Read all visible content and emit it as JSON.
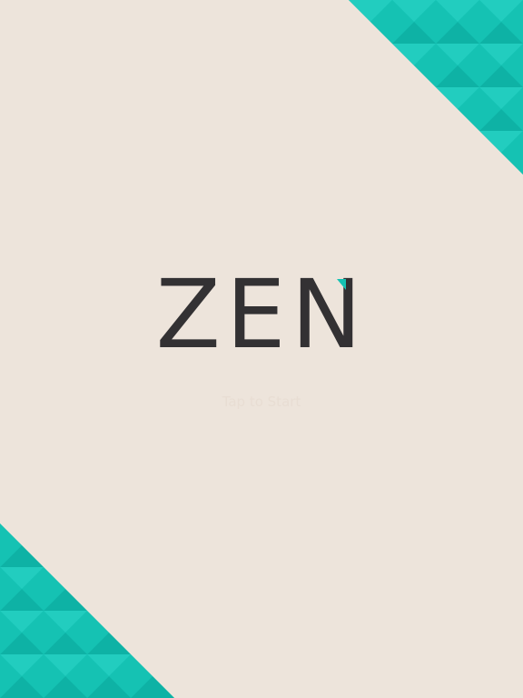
{
  "game": {
    "title": "ZEN",
    "start_prompt": "Tap to Start"
  },
  "colors": {
    "background": "#EDE4DB",
    "title_text": "#333133",
    "accent": "#15C2B3",
    "accent_dark": "#0EB2A5",
    "accent_light": "#22CDBF",
    "prompt_text": "#E8DDD3"
  },
  "icons": {
    "top_right_decoration": "triangle-pattern-corner",
    "bottom_left_decoration": "triangle-pattern-corner"
  }
}
